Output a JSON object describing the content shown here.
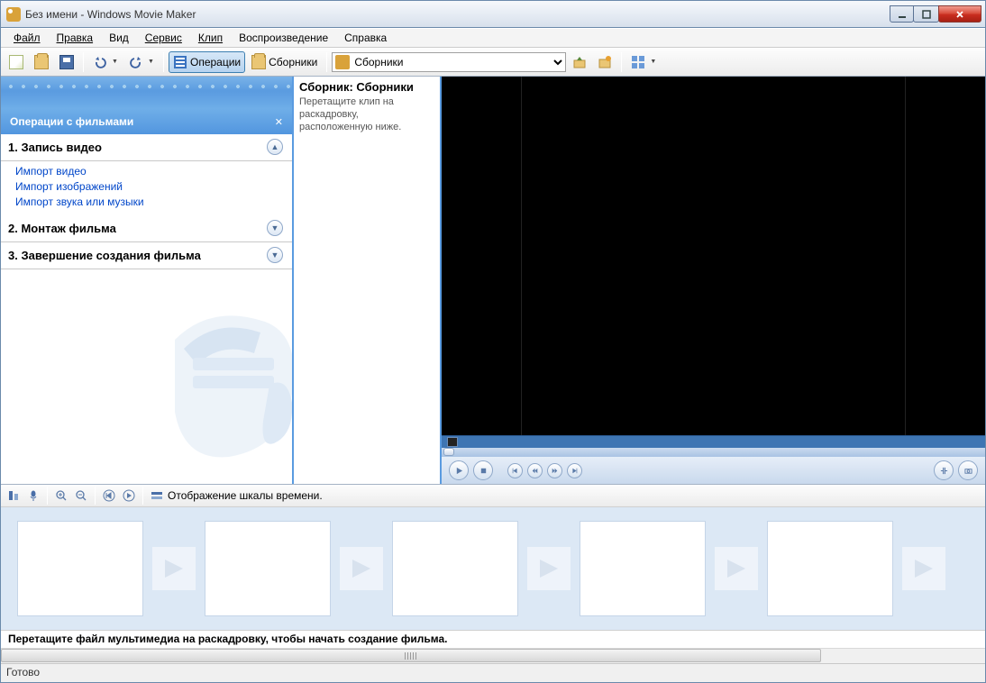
{
  "title": "Без имени - Windows Movie Maker",
  "menu": {
    "file": "Файл",
    "edit": "Правка",
    "view": "Вид",
    "service": "Сервис",
    "clip": "Клип",
    "play": "Воспроизведение",
    "help": "Справка"
  },
  "toolbar": {
    "operations": "Операции",
    "collections": "Сборники",
    "collections_sel": "Сборники"
  },
  "tasks": {
    "header": "Операции с фильмами",
    "section1": "1. Запись видео",
    "s1_links": {
      "a": "Импорт видео",
      "b": "Импорт изображений",
      "c": "Импорт звука или музыки"
    },
    "section2": "2. Монтаж фильма",
    "section3": "3. Завершение создания фильма"
  },
  "collection": {
    "title": "Сборник: Сборники",
    "instr": "Перетащите клип на раскадровку, расположенную ниже."
  },
  "timeline": {
    "toggle": "Отображение шкалы времени."
  },
  "storyboard": {
    "hint": "Перетащите файл мультимедиа на раскадровку, чтобы начать создание фильма."
  },
  "status": "Готово"
}
